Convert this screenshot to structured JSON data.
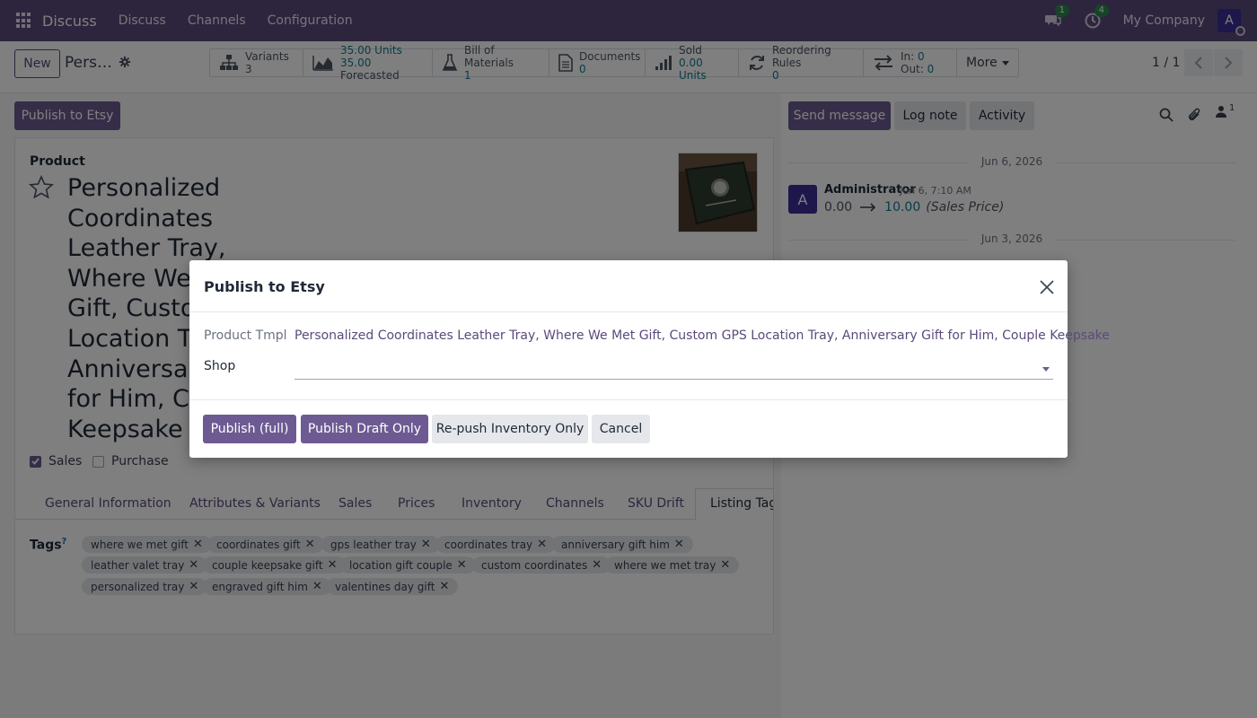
{
  "navbar": {
    "brand": "Discuss",
    "menu": [
      "Discuss",
      "Channels",
      "Configuration"
    ],
    "messages_badge": "1",
    "activities_badge": "4",
    "company": "My Company",
    "avatar_letter": "A"
  },
  "control_panel": {
    "new_label": "New",
    "record_title": "Pers…",
    "smart_buttons": [
      {
        "icon": "variants-icon",
        "label": "Variants",
        "value": "3"
      },
      {
        "icon": "forecast-chart-icon",
        "label": "35.00 Units",
        "value": "35.00",
        "value_suffix": "Forecasted"
      },
      {
        "icon": "flask-icon",
        "label": "Bill of Materials",
        "value": "1"
      },
      {
        "icon": "document-icon",
        "label": "Documents",
        "value": "0"
      },
      {
        "icon": "sold-bars-icon",
        "label": "Sold",
        "value": "0.00 Units"
      },
      {
        "icon": "refresh-icon",
        "label": "Reordering Rules",
        "value": "0"
      },
      {
        "icon": "transfer-arrows-icon",
        "label": "In:",
        "in_value": "0",
        "label2": "Out:",
        "out_value": "0"
      }
    ],
    "more_label": "More",
    "pager": "1 / 1"
  },
  "form": {
    "publish_button": "Publish to Etsy",
    "product_label": "Product",
    "product_name": "Personalized Coordinates Leather Tray, Where We Met Gift, Custom GPS Location Tray, Anniversary Gift for Him, Couple Keepsake",
    "product_name_visible_lines": [
      "Personalized",
      "Coordinates",
      "Leather Tray,",
      "Where We",
      "Gift, Custo",
      "Location Tr",
      "Anniversar",
      "for Him, Co",
      "Keepsake"
    ],
    "sales_label": "Sales",
    "sales_checked": true,
    "purchase_label": "Purchase",
    "purchase_checked": false,
    "tabs": [
      "General Information",
      "Attributes & Variants",
      "Sales",
      "Prices",
      "Inventory",
      "Channels",
      "SKU Drift",
      "Listing Tags"
    ],
    "active_tab": "Listing Tags",
    "tags_label": "Tags",
    "tags_help": "?",
    "tags": [
      "where we met gift",
      "coordinates gift",
      "gps leather tray",
      "coordinates tray",
      "anniversary gift him",
      "leather valet tray",
      "couple keepsake gift",
      "location gift couple",
      "custom coordinates",
      "where we met tray",
      "personalized tray",
      "engraved gift him",
      "valentines day gift"
    ]
  },
  "chatter": {
    "send_message": "Send message",
    "log_note": "Log note",
    "activity": "Activity",
    "followers_count": "1",
    "date1": "Jun 6, 2026",
    "date2": "Jun 3, 2026",
    "message": {
      "avatar": "A",
      "author": "Administrator",
      "time": "Jun 6, 7:10 AM",
      "old_value": "0.00",
      "new_value": "10.00",
      "field": "(Sales Price)"
    }
  },
  "dialog": {
    "title": "Publish to Etsy",
    "product_tmpl_label": "Product Tmpl",
    "product_tmpl_value": "Personalized Coordinates Leather Tray, Where We Met Gift, Custom GPS Location Tray, Anniversary Gift for Him, Couple Keepsake",
    "shop_label": "Shop",
    "shop_value": "",
    "buttons": {
      "publish_full": "Publish (full)",
      "publish_draft": "Publish Draft Only",
      "repush_inventory": "Re-push Inventory Only",
      "cancel": "Cancel"
    }
  },
  "colors": {
    "brand": "#5b4a7c",
    "primary_button": "#6d5a92",
    "teal_value": "#0f7b8f",
    "badge_green": "#2a8a4d"
  }
}
